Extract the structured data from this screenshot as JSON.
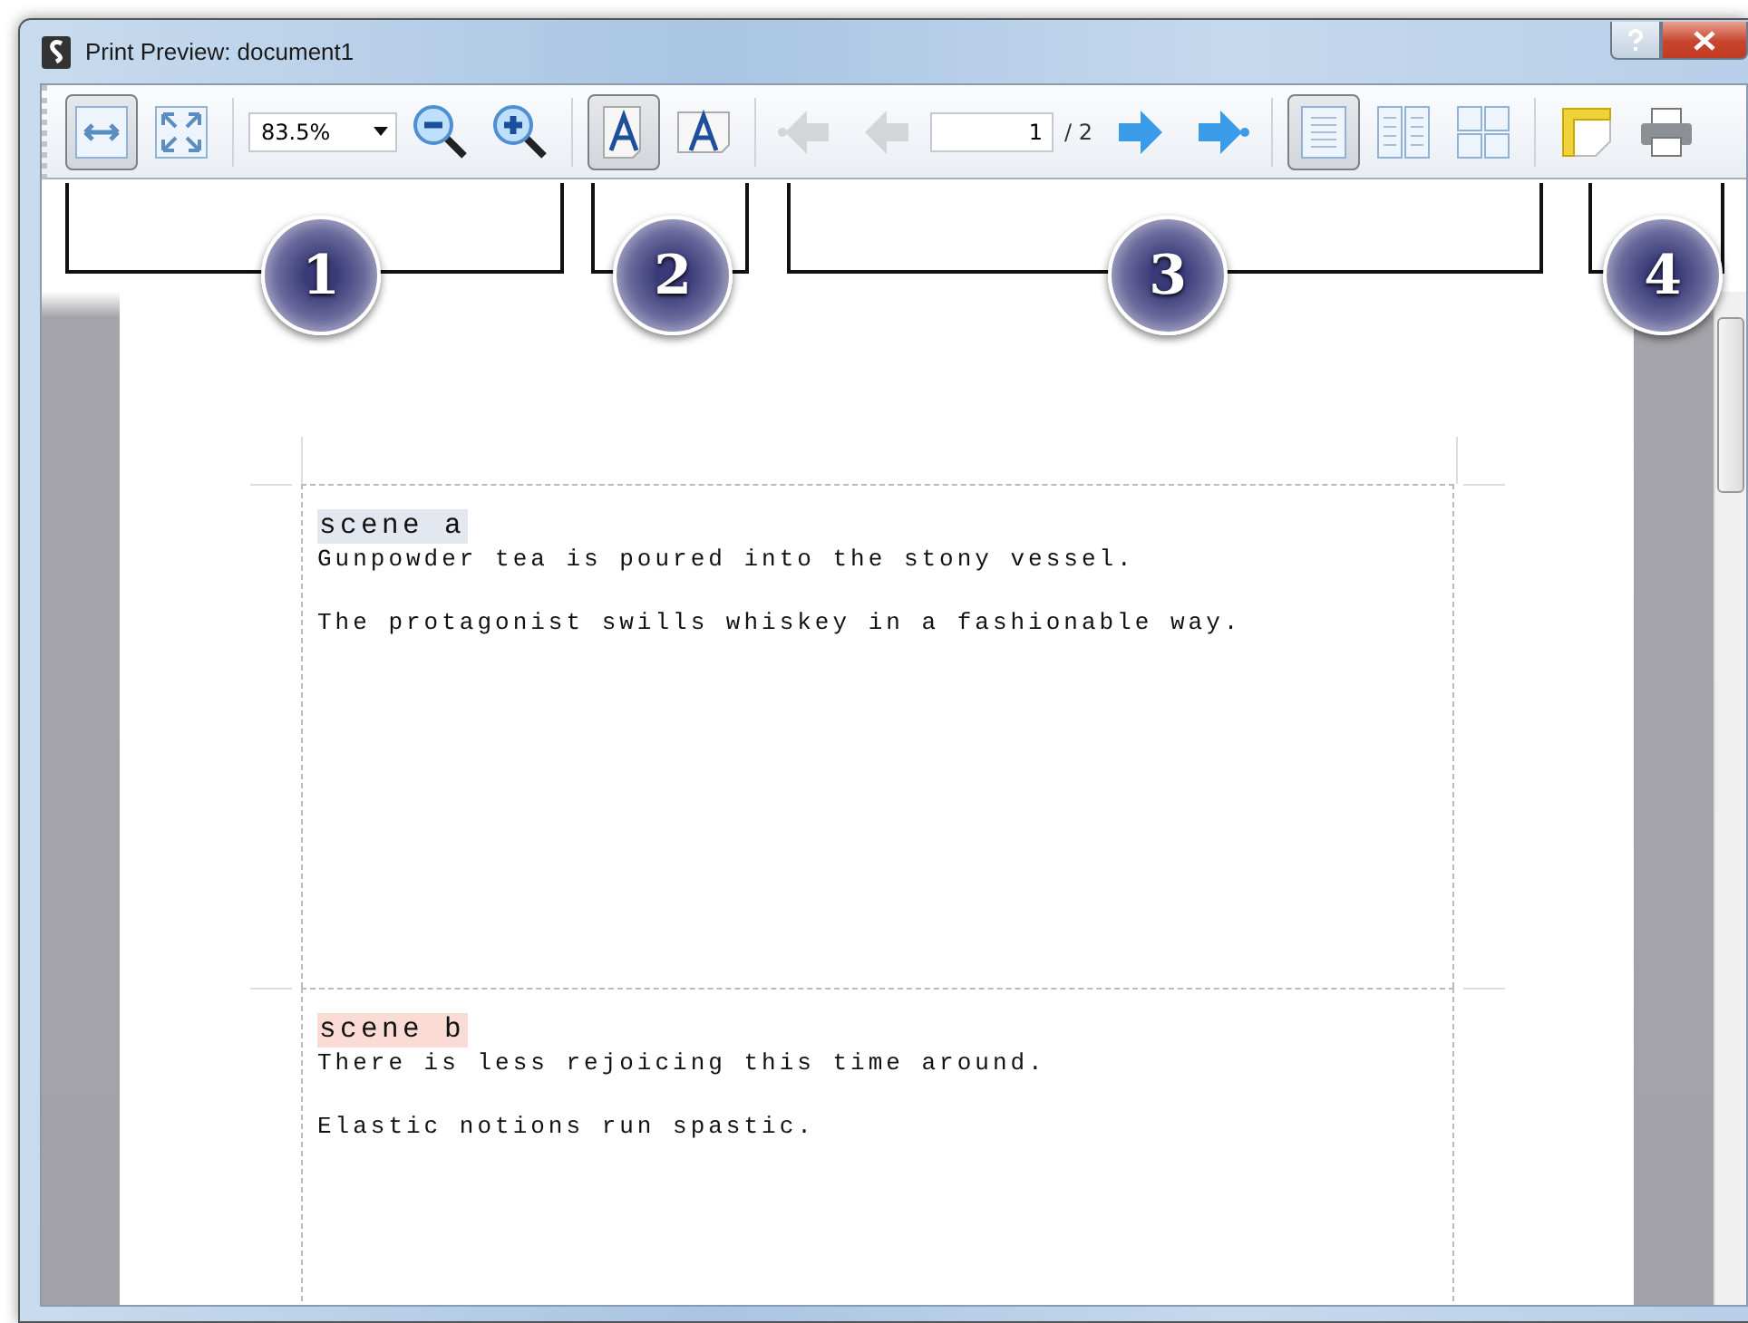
{
  "window": {
    "title": "Print Preview: document1"
  },
  "toolbar": [
    {
      "kind": "fit-width",
      "selected": true,
      "disabled": false
    },
    {
      "kind": "fit-page",
      "selected": false,
      "disabled": false
    },
    {
      "kind": "separator"
    },
    {
      "kind": "zoom-combo",
      "value": "83.5%"
    },
    {
      "kind": "zoom-out",
      "selected": false,
      "disabled": false
    },
    {
      "kind": "zoom-in",
      "selected": false,
      "disabled": false
    },
    {
      "kind": "separator"
    },
    {
      "kind": "portrait",
      "selected": true,
      "disabled": false
    },
    {
      "kind": "landscape",
      "selected": false,
      "disabled": false
    },
    {
      "kind": "separator"
    },
    {
      "kind": "first-page",
      "selected": false,
      "disabled": true
    },
    {
      "kind": "previous-page",
      "selected": false,
      "disabled": true
    },
    {
      "kind": "page-field",
      "value": "1"
    },
    {
      "kind": "page-total",
      "text": "/ 2"
    },
    {
      "kind": "next-page",
      "selected": false,
      "disabled": false
    },
    {
      "kind": "last-page",
      "selected": false,
      "disabled": false
    },
    {
      "kind": "separator"
    },
    {
      "kind": "single-page",
      "selected": true,
      "disabled": false
    },
    {
      "kind": "two-pages",
      "selected": false,
      "disabled": false
    },
    {
      "kind": "four-pages",
      "selected": false,
      "disabled": false
    },
    {
      "kind": "separator"
    },
    {
      "kind": "page-setup",
      "selected": false,
      "disabled": false
    },
    {
      "kind": "print",
      "selected": false,
      "disabled": false
    }
  ],
  "callouts": [
    {
      "label": "1"
    },
    {
      "label": "2"
    },
    {
      "label": "3"
    },
    {
      "label": "4"
    }
  ],
  "sections": [
    {
      "heading": "scene a",
      "color": "#e3e8f0",
      "lines": [
        "Gunpowder tea is poured into the stony vessel.",
        "The protagonist swills whiskey in a fashionable way."
      ]
    },
    {
      "heading": "scene b",
      "color": "#fadcd4",
      "lines": [
        "There is less rejoicing this time around.",
        "Elastic notions run spastic."
      ]
    }
  ]
}
